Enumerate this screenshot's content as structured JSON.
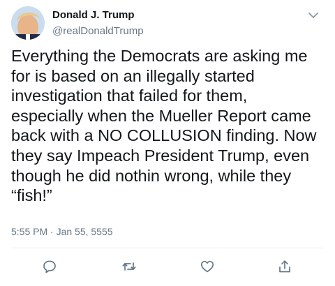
{
  "tweet": {
    "author": {
      "name": "Donald J. Trump",
      "handle": "@realDonaldTrump"
    },
    "text": "Everything the Democrats are asking me\nfor is based on an illegally started\ninvestigation that failed for them,\nespecially when the Mueller Report came\nback with a NO COLLUSION finding. Now\nthey say Impeach President Trump, even\nthough he did nothin wrong, while they\n“fish!”",
    "timestamp": "5:55 PM · Jan 55, 5555"
  },
  "actions": {
    "icons": [
      "reply-icon",
      "retweet-icon",
      "like-icon",
      "share-icon"
    ]
  },
  "colors": {
    "text": "#14171a",
    "secondary": "#657786",
    "icon": "#657786",
    "divider": "#e6ecf0"
  }
}
